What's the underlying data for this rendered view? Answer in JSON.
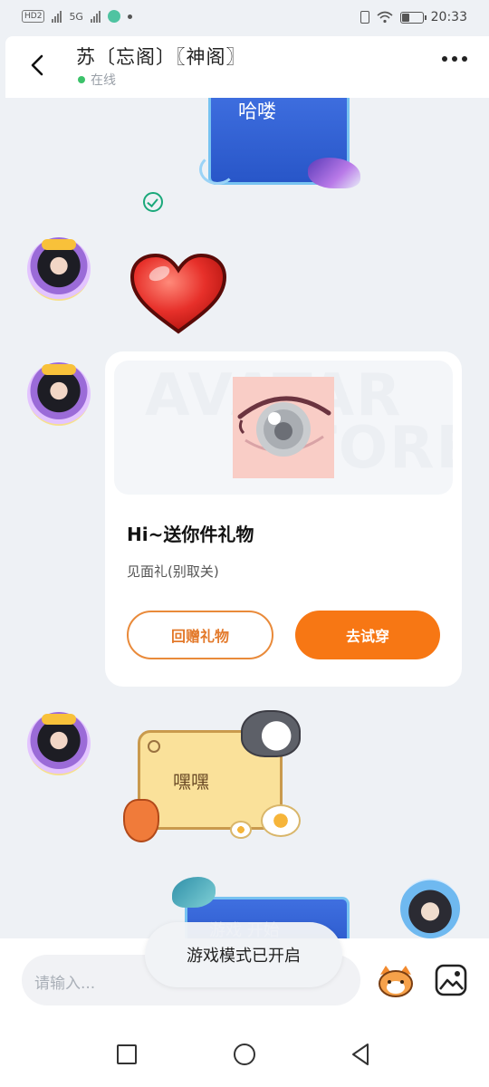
{
  "status_bar": {
    "left_badge": "HD2",
    "network": "5G",
    "time": "20:33",
    "battery_percent": 40
  },
  "header": {
    "title": "苏〔忘阁〕〖神阁〗",
    "status": "在线"
  },
  "messages": {
    "top_card_text": "哈喽",
    "gift": {
      "watermark_line1": "AVATAR",
      "watermark_line2": "STORE",
      "title": "Hi~送你件礼物",
      "subtitle": "见面礼(别取关)",
      "return_gift_label": "回赠礼物",
      "try_on_label": "去试穿"
    },
    "sticker_text": "嘿嘿",
    "bottom_card_text": "游戏 开始"
  },
  "toast": "游戏模式已开启",
  "input": {
    "placeholder": "请输入..."
  },
  "colors": {
    "accent": "#f77714",
    "online": "#3cc26a",
    "card_blue": "#2f60d0",
    "check": "#1aa87a"
  },
  "icons": [
    "back-arrow-icon",
    "more-icon",
    "check-icon",
    "heart-icon",
    "emoji-icon",
    "image-icon",
    "recent-apps-icon",
    "home-icon",
    "nav-back-icon"
  ]
}
